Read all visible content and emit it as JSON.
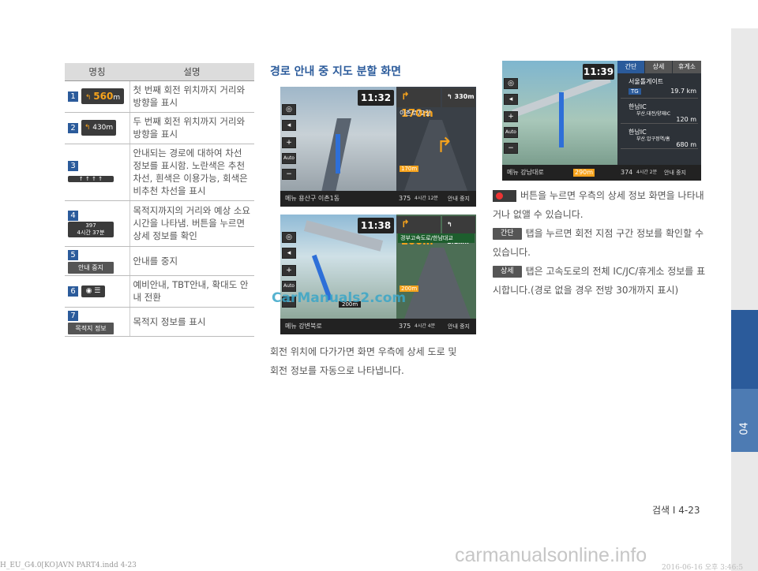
{
  "table": {
    "headers": [
      "명칭",
      "설명"
    ],
    "rows": [
      {
        "num": "1",
        "icon": "560",
        "icon_unit": "m",
        "desc": "첫 번째 회전 위치까지 거리와 방향을 표시"
      },
      {
        "num": "2",
        "icon": "430",
        "icon_unit": "m",
        "desc": "두 번째 회전 위치까지 거리와 방향을 표시"
      },
      {
        "num": "3",
        "icon": "lane-info",
        "desc": "안내되는 경로에 대하여 차선 정보를 표시함. 노란색은 추천차선, 흰색은 이용가능, 회색은 비추천 차선을 표시"
      },
      {
        "num": "4",
        "icon_top": "397",
        "icon_bottom": "4시간 37분",
        "desc": "목적지까지의 거리와 예상 소요 시간을 나타냄. 버튼을 누르면 상세 정보를 확인"
      },
      {
        "num": "5",
        "icon": "안내 중지",
        "desc": "안내를 중지"
      },
      {
        "num": "6",
        "icon": "view-toggle",
        "desc": "예비안내, TBT안내, 확대도 안내 전환"
      },
      {
        "num": "7",
        "icon": "목적지 정보",
        "desc": "목적지 정보를 표시"
      }
    ]
  },
  "section_title": "경로 안내 중 지도 분할 화면",
  "shot1": {
    "time": "11:32",
    "turn1": "170m",
    "turn2": "330m",
    "street": "이촌로72길",
    "bottom_bar": "메뉴   용산구 이촌1동",
    "dist": "375",
    "eta": "4시간 12분",
    "stop": "안내 중지",
    "lane_dist": "170m"
  },
  "shot2": {
    "time": "11:38",
    "turn1": "200m",
    "turn2": "1.1km",
    "street": "경부고속도로/한남대교",
    "bottom_bar": "메뉴   강변북로",
    "dist": "375",
    "eta": "4시간 4분",
    "stop": "안내 중지",
    "side_dist": "200m",
    "lane_dist": "200m"
  },
  "shot3": {
    "time": "11:39",
    "tabs": [
      "간단",
      "상세",
      "휴게소"
    ],
    "rows": [
      {
        "name": "서울톨게이트",
        "tag": "TG",
        "dist": "19.7 km"
      },
      {
        "name": "한남IC",
        "sub": "부산.대전/양재IC",
        "dist": "120 m"
      },
      {
        "name": "한남IC",
        "sub": "부산.압구정역/홈",
        "dist": "680 m"
      }
    ],
    "bottom_bar": "메뉴   강남대로",
    "lane_dist": "290m",
    "dist": "374",
    "eta": "4시간 2분",
    "stop": "안내 중지"
  },
  "para_left": [
    "회전 위치에 다가가면 화면 우측에 상세 도로 및",
    "회전 정보를 자동으로 나타냅니다."
  ],
  "para_right": {
    "p1": "버튼을 누르면 우측의 상세 정보 화면을 나타내거나 없앨 수 있습니다.",
    "chip2": "간단",
    "p2": "탭을 누르면 회전 지점 구간 정보를 확인할 수 있습니다.",
    "chip3": "상세",
    "p3": "탭은 고속도로의 전체 IC/JC/휴게소 정보를 표시합니다.(경로 없을 경우 전방 30개까지 표시)"
  },
  "watermark": "CarManuals2.com",
  "page_number": "검색 I 4-23",
  "chapter": "04",
  "footer_left": "H_EU_G4.0[KO]AVN PART4.indd   4-23",
  "footer_right": "2016-06-16   오후 3:46:5",
  "footer_site": "carmanualsonline.info"
}
